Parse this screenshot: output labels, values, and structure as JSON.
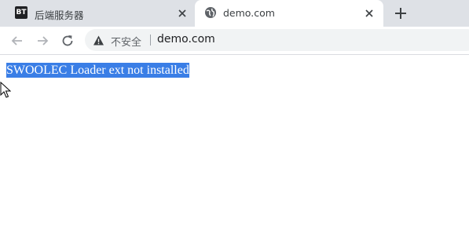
{
  "tabs": [
    {
      "favicon_text": "BT",
      "title": "后端服务器",
      "active": false
    },
    {
      "favicon": "globe-icon",
      "title": "demo.com",
      "active": true
    }
  ],
  "toolbar": {
    "security_label": "不安全",
    "url": "demo.com"
  },
  "page": {
    "message": "SWOOLEC Loader ext not installed"
  },
  "colors": {
    "tabstrip_bg": "#dee1e6",
    "selection": "#3a7ee6",
    "omnibox_bg": "#f1f3f4"
  }
}
